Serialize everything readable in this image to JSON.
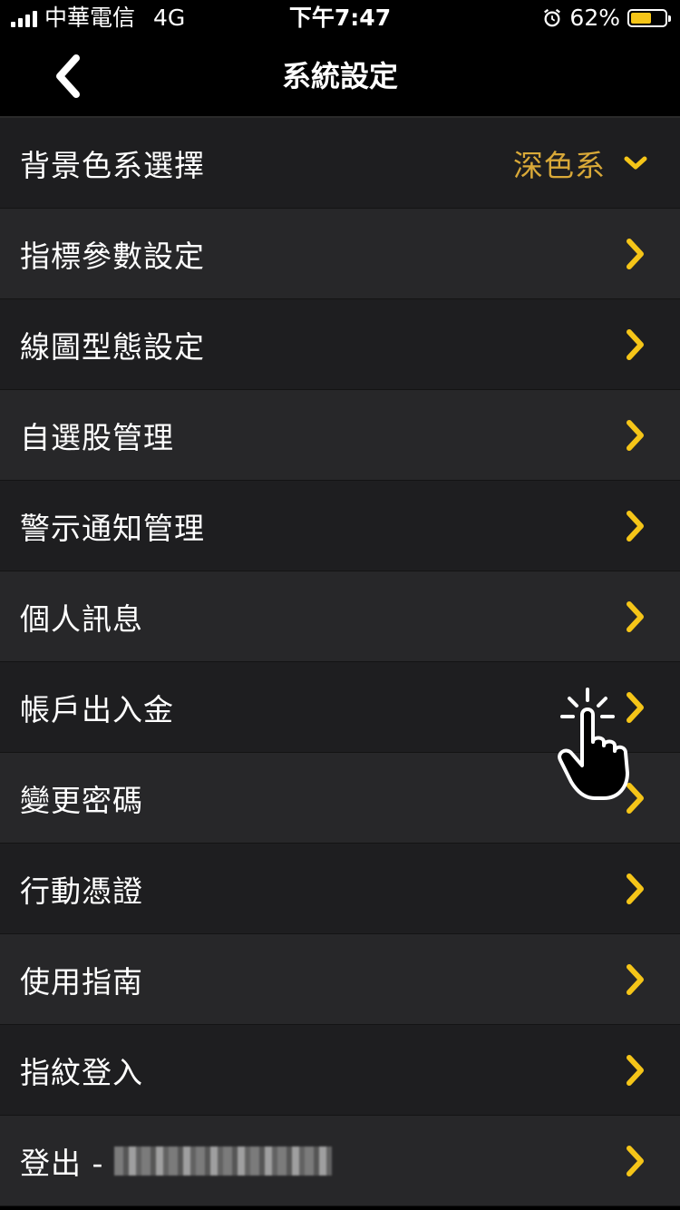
{
  "status_bar": {
    "carrier": "中華電信",
    "network": "4G",
    "time": "下午7:47",
    "battery_percent": "62%",
    "battery_level": 0.62,
    "alarm_icon": "alarm-clock-icon"
  },
  "header": {
    "title": "系統設定",
    "back_icon": "chevron-left-icon"
  },
  "settings": {
    "theme": {
      "label": "背景色系選擇",
      "value": "深色系"
    },
    "items": [
      {
        "label": "指標參數設定"
      },
      {
        "label": "線圖型態設定"
      },
      {
        "label": "自選股管理"
      },
      {
        "label": "警示通知管理"
      },
      {
        "label": "個人訊息"
      },
      {
        "label": "帳戶出入金"
      },
      {
        "label": "變更密碼"
      },
      {
        "label": "行動憑證"
      },
      {
        "label": "使用指南"
      },
      {
        "label": "指紋登入"
      }
    ],
    "logout": {
      "label": "登出 -"
    }
  },
  "colors": {
    "accent": "#f5c518",
    "value_text": "#d9a938",
    "row_light": "#272729",
    "row_dark": "#1e1e20"
  }
}
